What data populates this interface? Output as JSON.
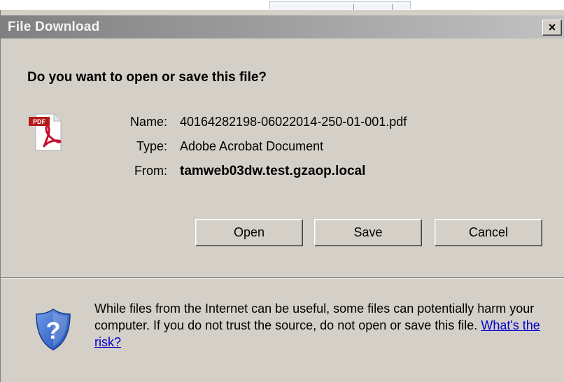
{
  "window": {
    "title": "File Download",
    "close_glyph": "×"
  },
  "dialog": {
    "question": "Do you want to open or save this file?",
    "file_icon": "pdf-file-icon",
    "name_label": "Name:",
    "name_value": "40164282198-06022014-250-01-001.pdf",
    "type_label": "Type:",
    "type_value": "Adobe Acrobat Document",
    "from_label": "From:",
    "from_value": "tamweb03dw.test.gzaop.local",
    "pdf_badge": "PDF"
  },
  "buttons": {
    "open": "Open",
    "save": "Save",
    "cancel": "Cancel"
  },
  "warning": {
    "icon": "security-shield-icon",
    "text": "While files from the Internet can be useful, some files can potentially harm your computer. If you do not trust the source, do not open or save this file. ",
    "link": "What's the risk?"
  },
  "colors": {
    "dialog_bg": "#d4d0c8",
    "titlebar_start": "#808080",
    "titlebar_end": "#c2c2c2",
    "link": "#0000cc"
  }
}
